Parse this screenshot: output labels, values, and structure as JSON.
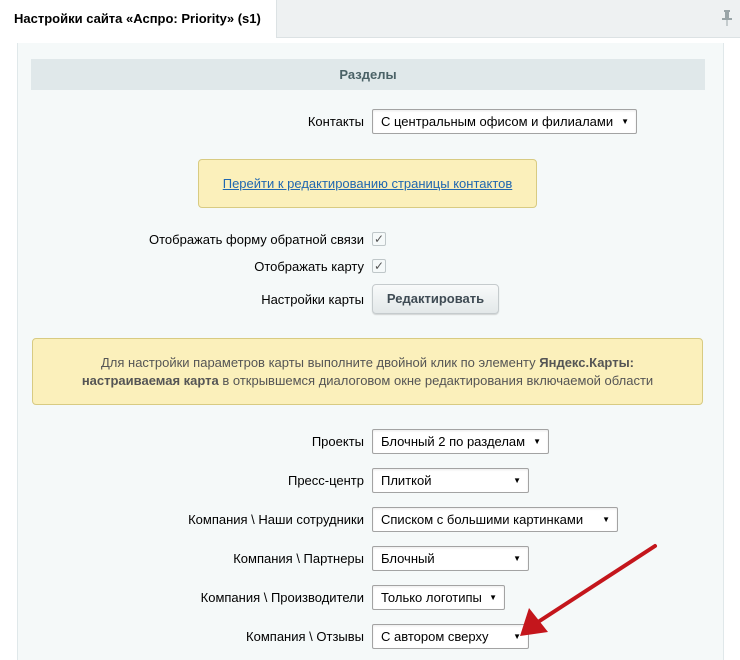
{
  "window": {
    "tab_title": "Настройки сайта «Аспро: Priority» (s1)"
  },
  "section": {
    "title": "Разделы"
  },
  "contacts": {
    "label": "Контакты",
    "value": "С центральным офисом и филиалами",
    "link_text": "Перейти к редактированию страницы контактов"
  },
  "feedback_form": {
    "label": "Отображать форму обратной связи",
    "checked": true
  },
  "show_map": {
    "label": "Отображать карту",
    "checked": true
  },
  "map_settings": {
    "label": "Настройки карты",
    "button": "Редактировать"
  },
  "map_info": {
    "text_1": "Для настройки параметров карты выполните двойной клик по элементу ",
    "bold_1": "Яндекс.Карты:",
    "bold_2": "настраиваемая карта",
    "text_2": " в открывшемся диалоговом окне редактирования включаемой области"
  },
  "settings": [
    {
      "label": "Проекты",
      "value": "Блочный 2 по разделам"
    },
    {
      "label": "Пресс-центр",
      "value": "Плиткой"
    },
    {
      "label": "Компания \\ Наши сотрудники",
      "value": "Списком с большими картинками"
    },
    {
      "label": "Компания \\ Партнеры",
      "value": "Блочный"
    },
    {
      "label": "Компания \\ Производители",
      "value": "Только логотипы"
    },
    {
      "label": "Компания \\ Отзывы",
      "value": "С автором сверху"
    }
  ],
  "icons": {
    "dropdown": "▼",
    "check": "✓",
    "pin": "pin-icon"
  },
  "colors": {
    "note_bg": "#fbf0bb",
    "link": "#2067b0",
    "arrow": "#c4161c"
  }
}
